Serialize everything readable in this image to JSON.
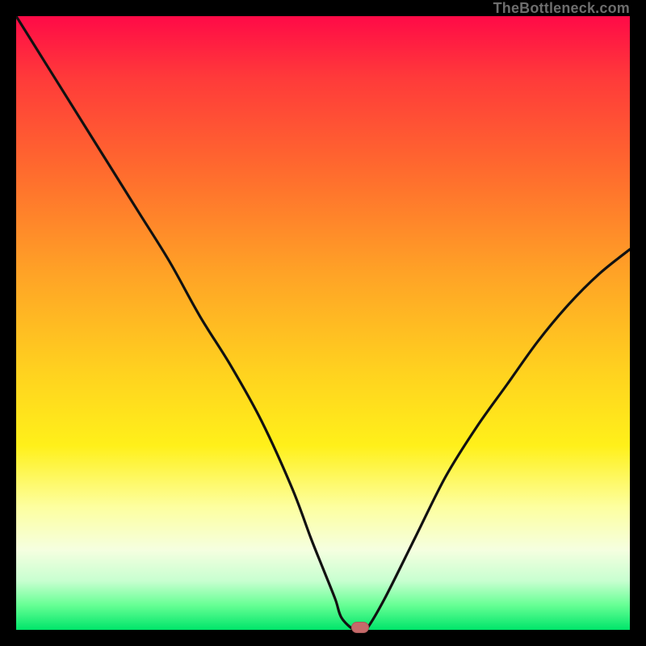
{
  "watermark": {
    "text": "TheBottleneck.com"
  },
  "chart_data": {
    "type": "line",
    "title": "",
    "xlabel": "",
    "ylabel": "",
    "xlim": [
      0,
      100
    ],
    "ylim": [
      0,
      100
    ],
    "series": [
      {
        "name": "bottleneck-curve",
        "x": [
          0,
          5,
          10,
          15,
          20,
          25,
          30,
          35,
          40,
          45,
          48,
          50,
          52,
          53,
          55,
          56,
          57,
          60,
          65,
          70,
          75,
          80,
          85,
          90,
          95,
          100
        ],
        "y": [
          100,
          92,
          84,
          76,
          68,
          60,
          51,
          43,
          34,
          23,
          15,
          10,
          5,
          2,
          0,
          0,
          0,
          5,
          15,
          25,
          33,
          40,
          47,
          53,
          58,
          62
        ]
      }
    ],
    "marker": {
      "x": 56,
      "y": 0
    },
    "gradient_stops": [
      {
        "pos": 0,
        "color": "#ff0a47"
      },
      {
        "pos": 10,
        "color": "#ff3a3a"
      },
      {
        "pos": 25,
        "color": "#ff6a2e"
      },
      {
        "pos": 42,
        "color": "#ffa326"
      },
      {
        "pos": 58,
        "color": "#ffd21f"
      },
      {
        "pos": 70,
        "color": "#fff01a"
      },
      {
        "pos": 80,
        "color": "#fdffa0"
      },
      {
        "pos": 87,
        "color": "#f5ffe0"
      },
      {
        "pos": 92,
        "color": "#c8ffd0"
      },
      {
        "pos": 96,
        "color": "#66ff94"
      },
      {
        "pos": 100,
        "color": "#00e56a"
      }
    ]
  }
}
